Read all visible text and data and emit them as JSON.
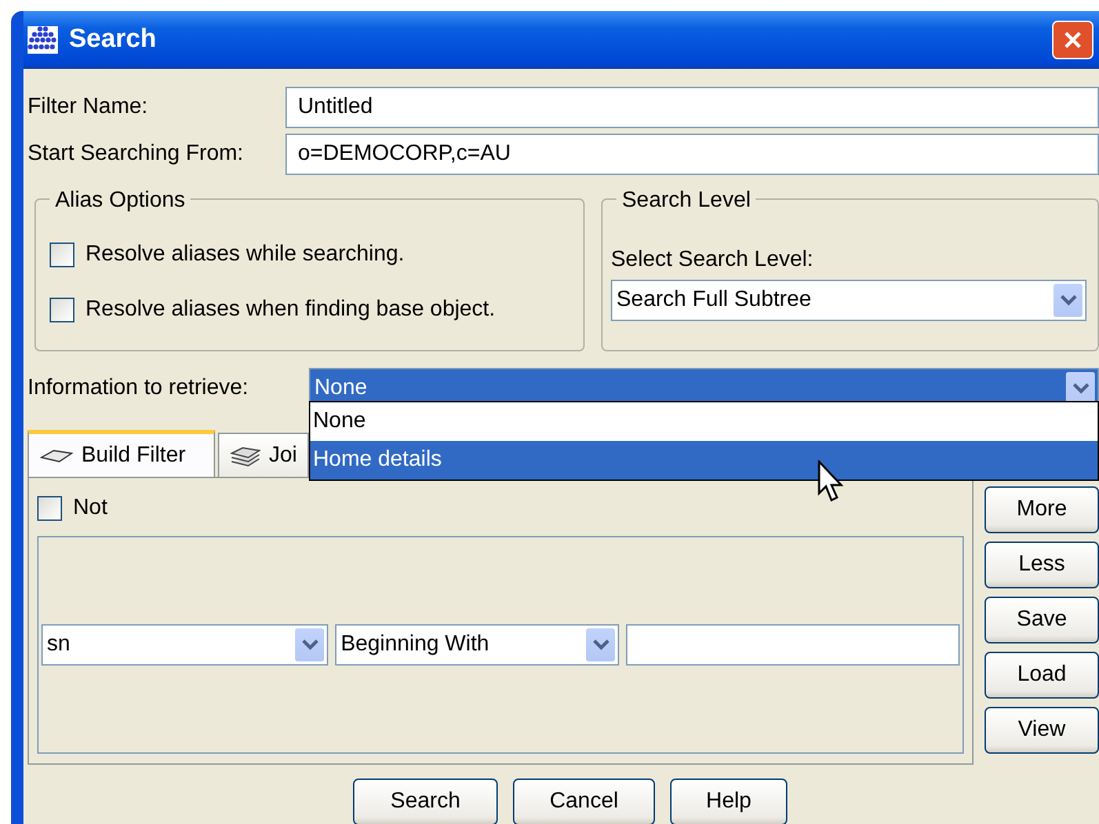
{
  "window": {
    "title": "Search"
  },
  "filter_name": {
    "label": "Filter Name:",
    "value": "Untitled"
  },
  "start_from": {
    "label": "Start Searching From:",
    "value": "o=DEMOCORP,c=AU"
  },
  "alias_options": {
    "title": "Alias Options",
    "options": [
      {
        "label": "Resolve aliases while searching.",
        "checked": false
      },
      {
        "label": "Resolve aliases when finding base object.",
        "checked": false
      }
    ]
  },
  "search_level": {
    "title": "Search Level",
    "label": "Select Search Level:",
    "value": "Search Full Subtree"
  },
  "information": {
    "label": "Information to retrieve:",
    "value": "None",
    "expanded": true,
    "options": [
      {
        "label": "None",
        "highlighted": false
      },
      {
        "label": "Home details",
        "highlighted": true
      }
    ]
  },
  "tabs": [
    {
      "label": "Build Filter",
      "selected": true
    },
    {
      "label": "Joi",
      "selected": false
    }
  ],
  "not": {
    "label": "Not",
    "checked": false
  },
  "filter_row": {
    "attribute": "sn",
    "operator": "Beginning With"
  },
  "side_buttons": [
    "More",
    "Less",
    "Save",
    "Load",
    "View"
  ],
  "buttons": [
    "Search",
    "Cancel",
    "Help"
  ]
}
